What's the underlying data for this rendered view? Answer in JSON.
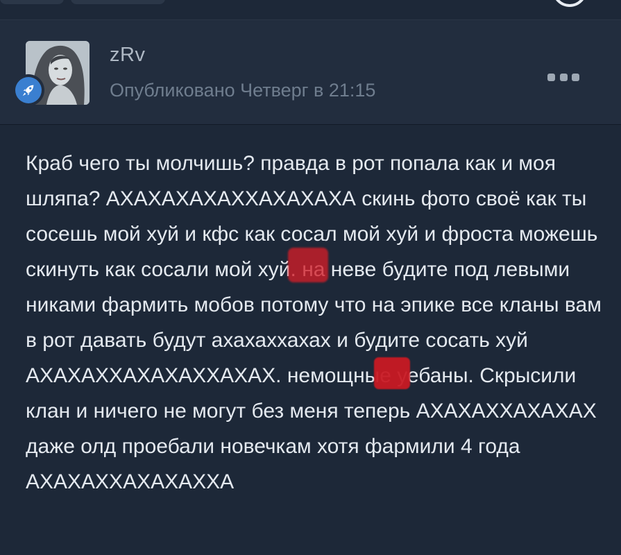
{
  "post": {
    "author": "zRv",
    "published": "Опубликовано Четверг в 21:15",
    "text": "Краб чего  ты молчишь? правда в рот попала как и моя шляпа? АХАХАХАХАХХАХАХАХА скинь фото своё как ты сосешь мой хуй и кфс как сосал мой хуй и фроста можешь скинуть как сосали мой хуй. на неве будите под левыми никами фармить мобов потому что на эпике все кланы вам в рот давать будут ахахаххахах и будите сосать хуй АХАХАХХАХАХАХХАХАХ. немощные уебаны. Скрысили клан и ничего не могут без меня теперь АХАХАХХАХАХАХ даже олд проебали новечкам хотя фармили 4 года АХАХАХХАХАХАХХА"
  },
  "icons": {
    "badge": "rocket-icon",
    "menu": "more-dots-icon"
  },
  "colors": {
    "background": "#1d2838",
    "header_background": "#222d3e",
    "badge": "#3a7fd0",
    "text": "#e4e9ef",
    "muted_text": "#6f7d8e",
    "censor_mark": "#c8202a"
  }
}
